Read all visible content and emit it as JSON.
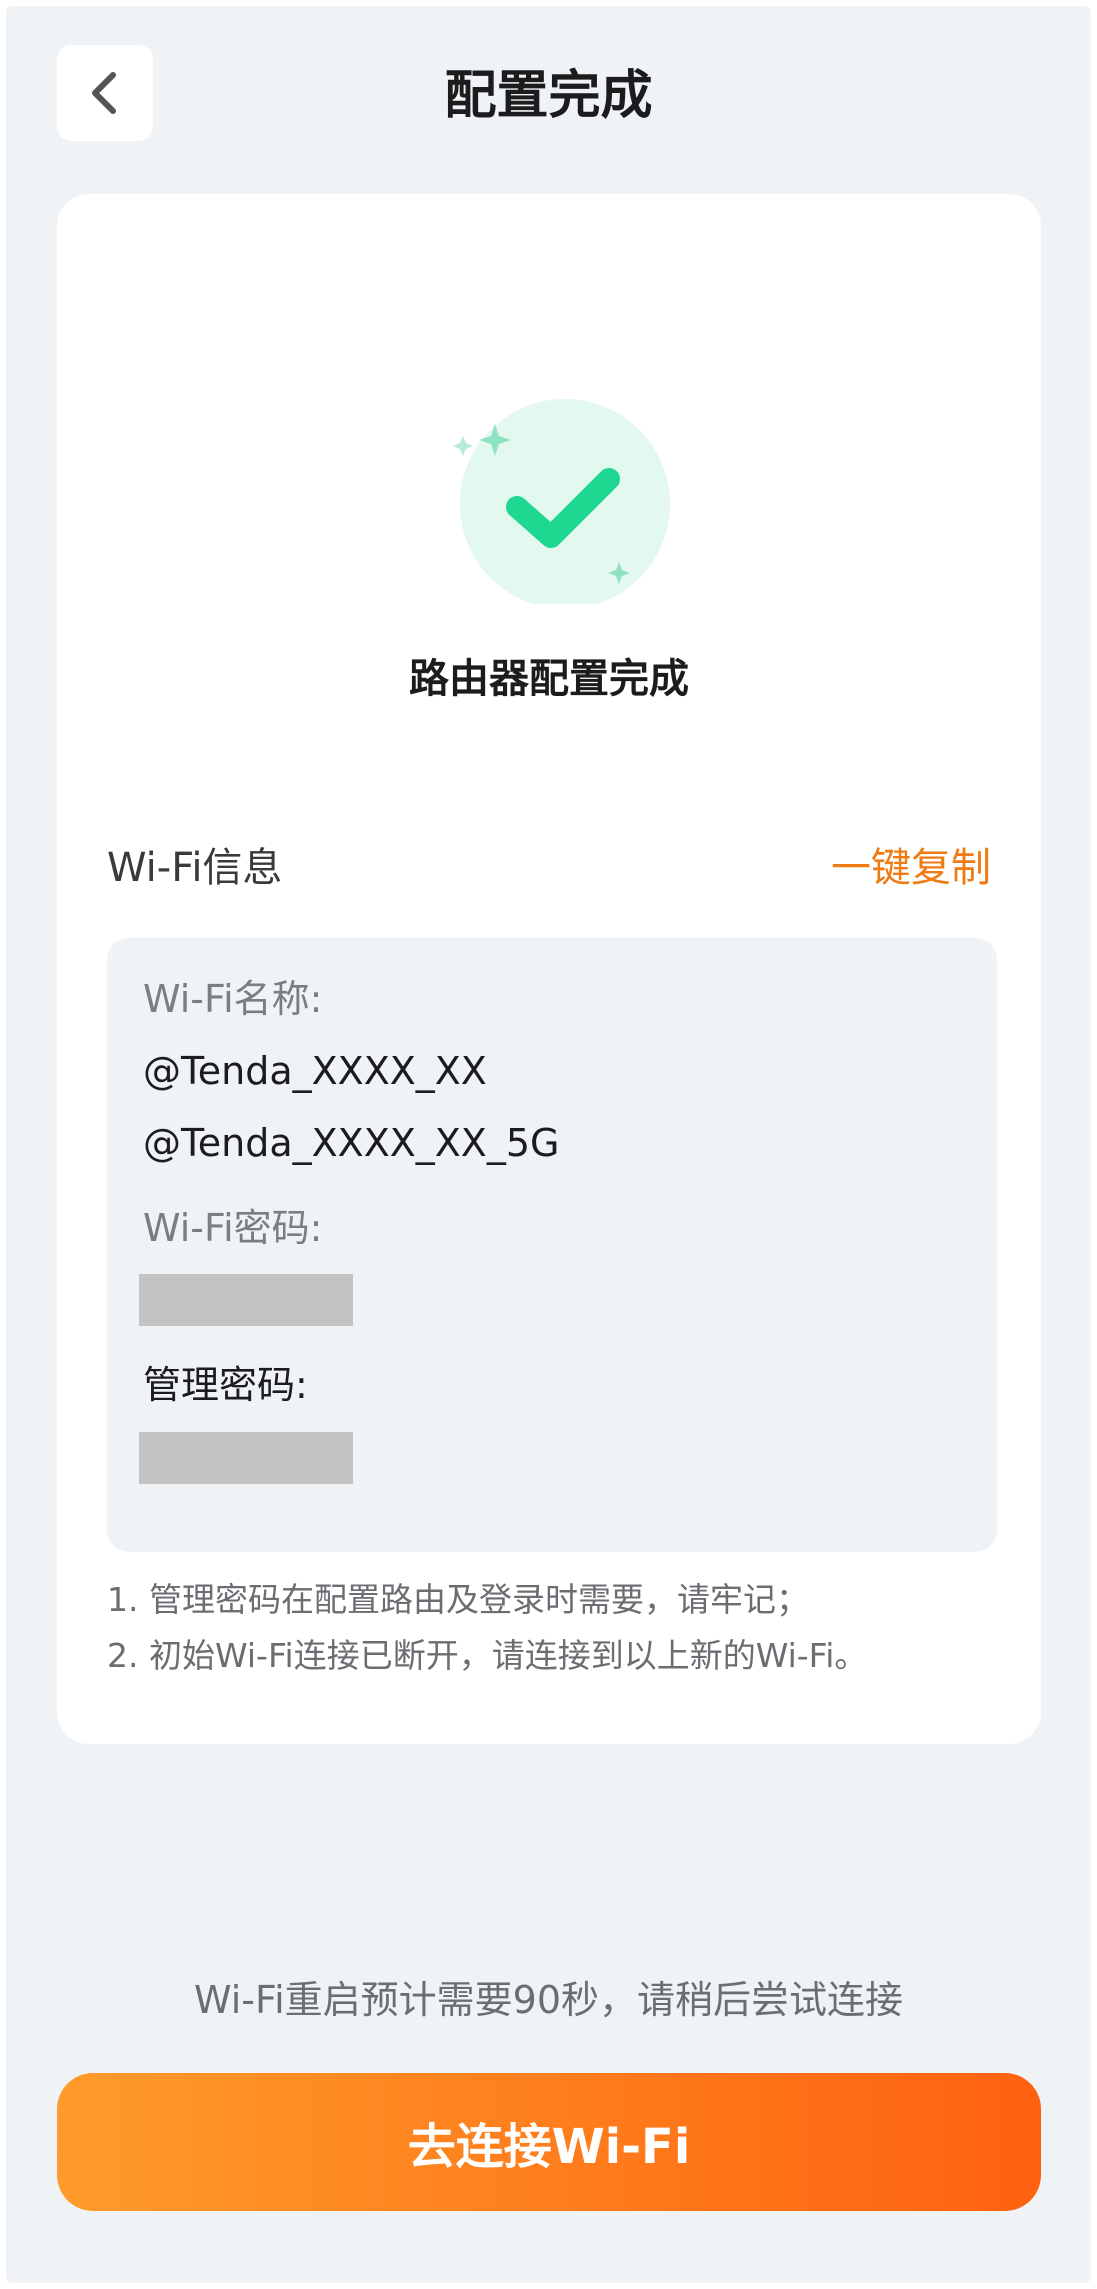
{
  "header": {
    "title": "配置完成",
    "back_icon": "chevron-left-icon"
  },
  "success": {
    "icon": "check-circle-icon",
    "accent_color": "#1ed891",
    "title": "路由器配置完成"
  },
  "wifi_info": {
    "section_title": "Wi-Fi信息",
    "copy_label": "一键复制",
    "name_label": "Wi-Fi名称:",
    "ssid_24g": "@Tenda_XXXX_XX",
    "ssid_5g": "@Tenda_XXXX_XX_5G",
    "password_label": "Wi-Fi密码:",
    "admin_password_label": "管理密码:"
  },
  "notes": [
    "1. 管理密码在配置路由及登录时需要，请牢记；",
    "2. 初始Wi-Fi连接已断开，请连接到以上新的Wi-Fi。"
  ],
  "restart_hint": "Wi-Fi重启预计需要90秒，请稍后尝试连接",
  "connect_button": {
    "label": "去连接Wi-Fi"
  },
  "colors": {
    "accent_orange": "#f07b12",
    "button_gradient_start": "#ff9b2a",
    "button_gradient_end": "#ff6110",
    "background": "#f0f3f6"
  }
}
